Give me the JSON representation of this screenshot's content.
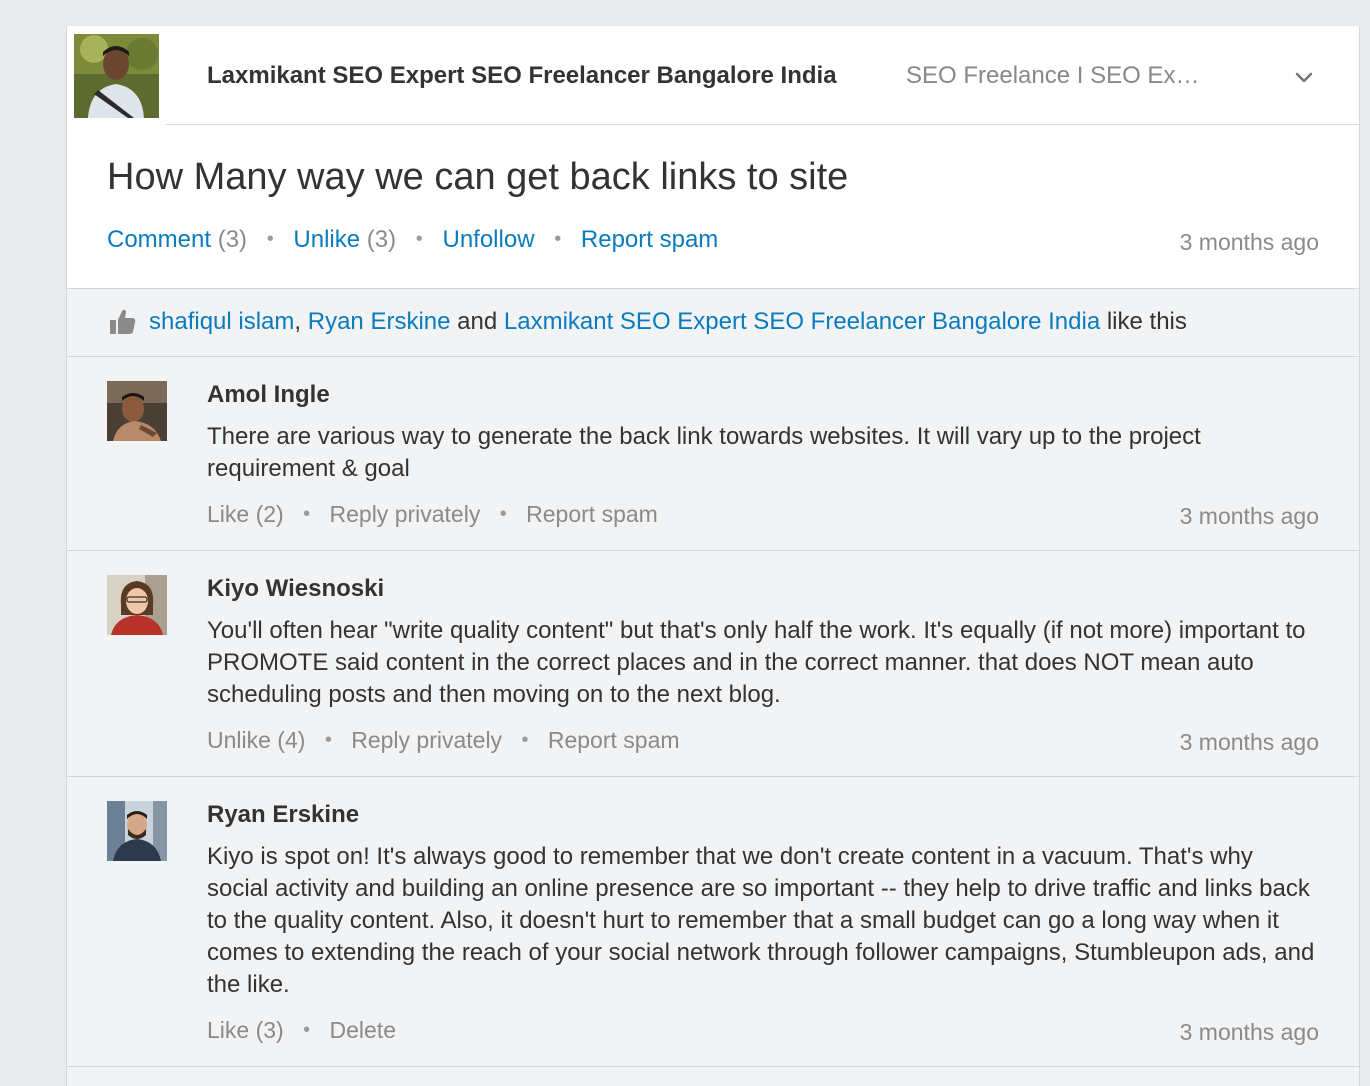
{
  "post": {
    "author_name": "Laxmikant SEO Expert SEO Freelancer Bangalore India",
    "author_headline": "SEO Freelance I SEO Ex…",
    "title": "How Many way we can get back links to site",
    "actions": {
      "comment_label": "Comment",
      "comment_count": "(3)",
      "unlike_label": "Unlike",
      "unlike_count": "(3)",
      "unfollow_label": "Unfollow",
      "report_label": "Report spam"
    },
    "timestamp": "3 months ago"
  },
  "likes": {
    "user1": "shafiqul islam",
    "sep1": ",",
    "user2": "Ryan Erskine",
    "and": "and",
    "user3": "Laxmikant SEO Expert SEO Freelancer Bangalore India",
    "suffix": "like this"
  },
  "comments": [
    {
      "name": "Amol Ingle",
      "body": "There are various way to generate the back link towards websites. It will vary up to the project requirement & goal",
      "action1": "Like (2)",
      "action2": "Reply privately",
      "action3": "Report spam",
      "timestamp": "3 months ago"
    },
    {
      "name": "Kiyo Wiesnoski",
      "body": "You'll often hear \"write quality content\" but that's only half the work. It's equally (if not more) important to PROMOTE said content in the correct places and in the correct manner. that does NOT mean auto scheduling posts and then moving on to the next blog.",
      "action1": "Unlike (4)",
      "action2": "Reply privately",
      "action3": "Report spam",
      "timestamp": "3 months ago"
    },
    {
      "name": "Ryan Erskine",
      "body": "Kiyo is spot on! It's always good to remember that we don't create content in a vacuum. That's why social activity and building an online presence are so important -- they help to drive traffic and links back to the quality content. Also, it doesn't hurt to remember that a small budget can go a long way when it comes to extending the reach of your social network through follower campaigns, Stumbleupon ads, and the like.",
      "action1": "Like (3)",
      "action2": "Delete",
      "timestamp": "3 months ago"
    }
  ],
  "icons": {
    "chevron": "chevron-down-icon",
    "thumb": "thumbs-up-icon"
  },
  "colors": {
    "link": "#0a7bbf",
    "muted": "#8a8a8a",
    "background": "#f2f3f4"
  }
}
